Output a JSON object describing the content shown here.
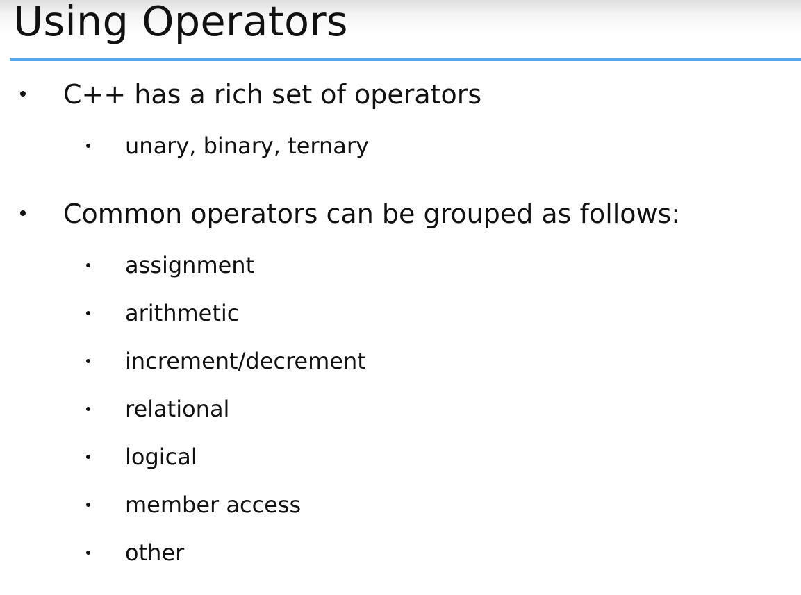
{
  "slide": {
    "title": "Using Operators",
    "accent_color": "#5aa6e6",
    "bullets": [
      {
        "text": "C++ has a rich set of operators"
      },
      {
        "text": "unary, binary, ternary"
      },
      {
        "text": "Common operators can be grouped as follows:"
      },
      {
        "text": "assignment"
      },
      {
        "text": "arithmetic"
      },
      {
        "text": "increment/decrement"
      },
      {
        "text": "relational"
      },
      {
        "text": "logical"
      },
      {
        "text": "member access"
      },
      {
        "text": "other"
      }
    ]
  }
}
